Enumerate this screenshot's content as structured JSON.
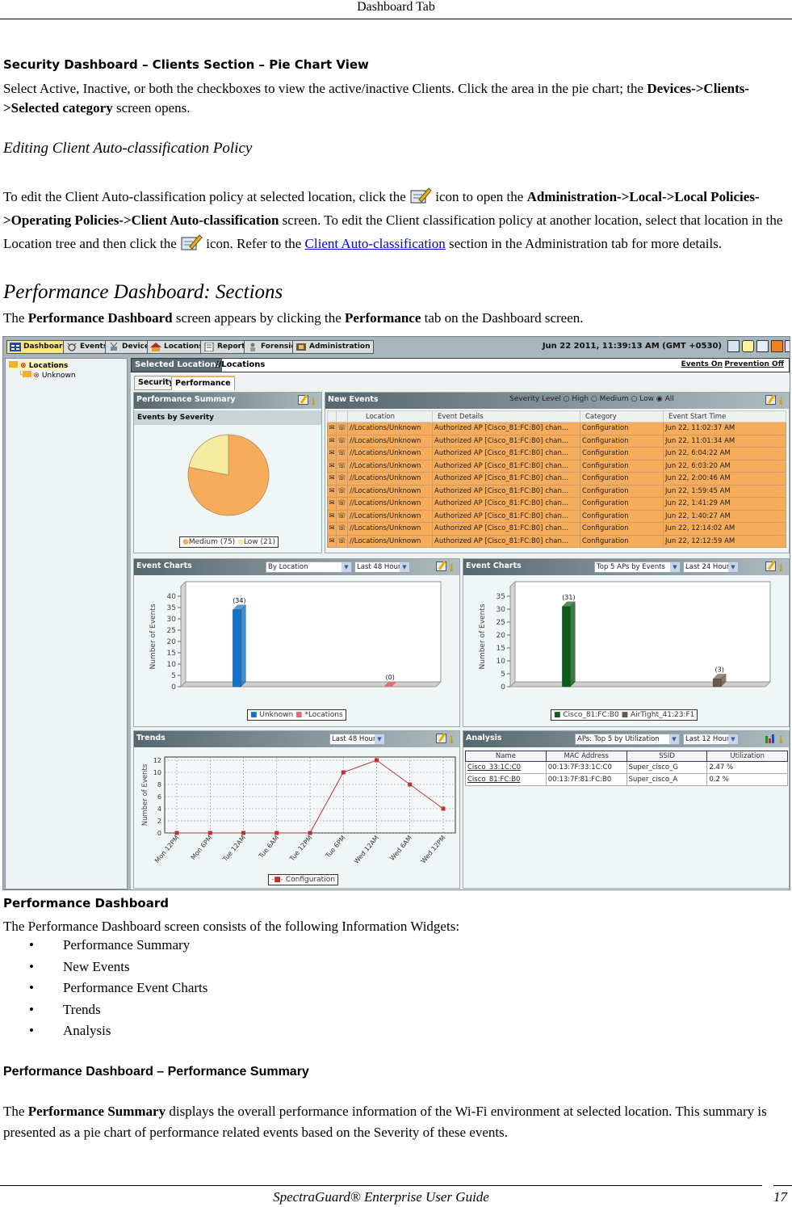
{
  "page": {
    "header": "Dashboard Tab",
    "footer_title": "SpectraGuard® Enterprise User Guide",
    "page_number": "17"
  },
  "sec1": {
    "heading": "Security Dashboard – Clients Section – Pie Chart View",
    "p1_a": "Select Active, Inactive, or both the checkboxes to view the active/inactive Clients. Click the area in the pie chart; the ",
    "p1_b": "Devices->Clients->Selected category",
    "p1_c": " screen opens."
  },
  "sec2": {
    "heading": "Editing Client Auto-classification Policy",
    "p_a": "To edit the Client Auto-classification policy at selected location, click the ",
    "p_b": " icon to open the ",
    "p_c": "Administration->Local->Local Policies->Operating Policies->Client Auto-classification",
    "p_d": " screen. To edit the Client classification policy at another location, select that location in the Location tree and then click the ",
    "p_e": " icon. Refer to the ",
    "link": "Client Auto-classification",
    "p_f": " section in the Administration tab for more details."
  },
  "sec3": {
    "heading": "Performance Dashboard: Sections",
    "p_a": "The ",
    "p_b": "Performance Dashboard",
    "p_c": " screen appears by clicking the ",
    "p_d": "Performance",
    "p_e": " tab on the Dashboard screen."
  },
  "app": {
    "nav_tabs": [
      {
        "label": "Dashboard",
        "icon": "dashboard-icon"
      },
      {
        "label": "Events",
        "icon": "events-icon"
      },
      {
        "label": "Devices",
        "icon": "devices-icon"
      },
      {
        "label": "Locations",
        "icon": "locations-icon"
      },
      {
        "label": "Reports",
        "icon": "reports-icon"
      },
      {
        "label": "Forensics",
        "icon": "forensics-icon"
      },
      {
        "label": "Administration",
        "icon": "administration-icon"
      }
    ],
    "datetime": "Jun 22 2011, 11:39:13 AM (GMT +0530)",
    "tree": {
      "root": "Locations",
      "child": "Unknown"
    },
    "selected_location_label": "Selected Location:",
    "selected_location_value": "//Locations",
    "events_link": "Events On",
    "prevention_link": "Prevention Off",
    "subtabs": [
      "Security",
      "Performance"
    ],
    "perf_summary": {
      "title": "Performance Summary",
      "subtitle": "Events by Severity",
      "legend": [
        "Medium (75)",
        "Low (21)"
      ]
    },
    "new_events": {
      "title": "New Events",
      "severity_label": "Severity Level",
      "severity_options": [
        "High",
        "Medium",
        "Low",
        "All"
      ],
      "severity_selected": "All",
      "columns": [
        "",
        "",
        "Location",
        "Event Details",
        "Category",
        "Event Start Time"
      ],
      "rows": [
        {
          "location": "//Locations/Unknown",
          "details": "Authorized AP [Cisco_81:FC:B0] chan...",
          "category": "Configuration",
          "time": "Jun 22, 11:02:37 AM"
        },
        {
          "location": "//Locations/Unknown",
          "details": "Authorized AP [Cisco_81:FC:B0] chan...",
          "category": "Configuration",
          "time": "Jun 22, 11:01:34 AM"
        },
        {
          "location": "//Locations/Unknown",
          "details": "Authorized AP [Cisco_81:FC:B0] chan...",
          "category": "Configuration",
          "time": "Jun 22, 6:04:22 AM"
        },
        {
          "location": "//Locations/Unknown",
          "details": "Authorized AP [Cisco_81:FC:B0] chan...",
          "category": "Configuration",
          "time": "Jun 22, 6:03:20 AM"
        },
        {
          "location": "//Locations/Unknown",
          "details": "Authorized AP [Cisco_81:FC:B0] chan...",
          "category": "Configuration",
          "time": "Jun 22, 2:00:46 AM"
        },
        {
          "location": "//Locations/Unknown",
          "details": "Authorized AP [Cisco_81:FC:B0] chan...",
          "category": "Configuration",
          "time": "Jun 22, 1:59:45 AM"
        },
        {
          "location": "//Locations/Unknown",
          "details": "Authorized AP [Cisco_81:FC:B0] chan...",
          "category": "Configuration",
          "time": "Jun 22, 1:41:29 AM"
        },
        {
          "location": "//Locations/Unknown",
          "details": "Authorized AP [Cisco_81:FC:B0] chan...",
          "category": "Configuration",
          "time": "Jun 22, 1:40:27 AM"
        },
        {
          "location": "//Locations/Unknown",
          "details": "Authorized AP [Cisco_81:FC:B0] chan...",
          "category": "Configuration",
          "time": "Jun 22, 12:14:02 AM"
        },
        {
          "location": "//Locations/Unknown",
          "details": "Authorized AP [Cisco_81:FC:B0] chan...",
          "category": "Configuration",
          "time": "Jun 22, 12:12:59 AM"
        }
      ]
    },
    "event_chart_1": {
      "title": "Event Charts",
      "select_1": "By Location",
      "select_2": "Last 48 Hours"
    },
    "event_chart_2": {
      "title": "Event Charts",
      "select_1": "Top 5 APs by Events",
      "select_2": "Last 24 Hours"
    },
    "trends": {
      "title": "Trends",
      "select_1": "Last 48 Hours"
    },
    "analysis": {
      "title": "Analysis",
      "select_1": "APs: Top 5 by Utilization",
      "select_2": "Last 12 Hours",
      "columns": [
        "Name",
        "MAC Address",
        "SSID",
        "Utilization"
      ],
      "rows": [
        {
          "name": "Cisco_33:1C:C0",
          "mac": "00:13:7F:33:1C:C0",
          "ssid": "Super_cisco_G",
          "util": "2.47 %"
        },
        {
          "name": "Cisco_81:FC:B0",
          "mac": "00:13:7F:81:FC:B0",
          "ssid": "Super_cisco_A",
          "util": "0.2 %"
        }
      ]
    }
  },
  "sec4": {
    "caption": "Performance Dashboard",
    "intro": "The Performance Dashboard screen consists of the following Information Widgets:",
    "bullets": [
      "Performance Summary",
      "New Events",
      "Performance Event Charts",
      "Trends",
      "Analysis"
    ]
  },
  "sec5": {
    "heading": "Performance Dashboard – Performance Summary",
    "p_a": "The ",
    "p_b": "Performance Summary",
    "p_c": " displays the overall performance information of the Wi-Fi environment at selected location. This summary is presented as a pie chart of performance related events based on the Severity of these events."
  },
  "chart_data": [
    {
      "type": "pie",
      "title": "Events by Severity",
      "categories": [
        "Medium",
        "Low"
      ],
      "values": [
        75,
        21
      ],
      "colors": [
        "#f7ac5c",
        "#f5eca0"
      ],
      "legend": "bottom"
    },
    {
      "type": "bar",
      "title": "Event Charts – By Location",
      "categories": [
        "Unknown",
        "*Locations"
      ],
      "values": [
        34,
        0
      ],
      "data_labels": [
        "(34)",
        "(0)"
      ],
      "colors": [
        "#0a74d0",
        "#e07070"
      ],
      "ylabel": "Number of Events",
      "ylim": [
        0,
        40
      ],
      "yticks": [
        0,
        5,
        10,
        15,
        20,
        25,
        30,
        35,
        40
      ],
      "legend": "bottom"
    },
    {
      "type": "bar",
      "title": "Event Charts – Top 5 APs by Events",
      "categories": [
        "Cisco_81:FC:B0",
        "AirTight_41:23:F1"
      ],
      "values": [
        31,
        3
      ],
      "data_labels": [
        "(31)",
        "(3)"
      ],
      "colors": [
        "#0b5e14",
        "#6b5a48"
      ],
      "ylabel": "Number of Events",
      "ylim": [
        0,
        35
      ],
      "yticks": [
        0,
        5,
        10,
        15,
        20,
        25,
        30,
        35
      ],
      "legend": "bottom"
    },
    {
      "type": "line",
      "title": "Trends",
      "x": [
        "Mon 12PM",
        "Mon 6PM",
        "Tue 12AM",
        "Tue 6AM",
        "Tue 12PM",
        "Tue 6PM",
        "Wed 12AM",
        "Wed 6AM",
        "Wed 12PM"
      ],
      "series": [
        {
          "name": "Configuration",
          "values": [
            0,
            0,
            0,
            0,
            0,
            10,
            12,
            8,
            4
          ],
          "color": "#b83434"
        }
      ],
      "ylabel": "Number of Events",
      "ylim": [
        0,
        12
      ],
      "yticks": [
        0,
        2,
        4,
        6,
        8,
        10,
        12
      ],
      "grid": true,
      "legend": "bottom"
    }
  ]
}
